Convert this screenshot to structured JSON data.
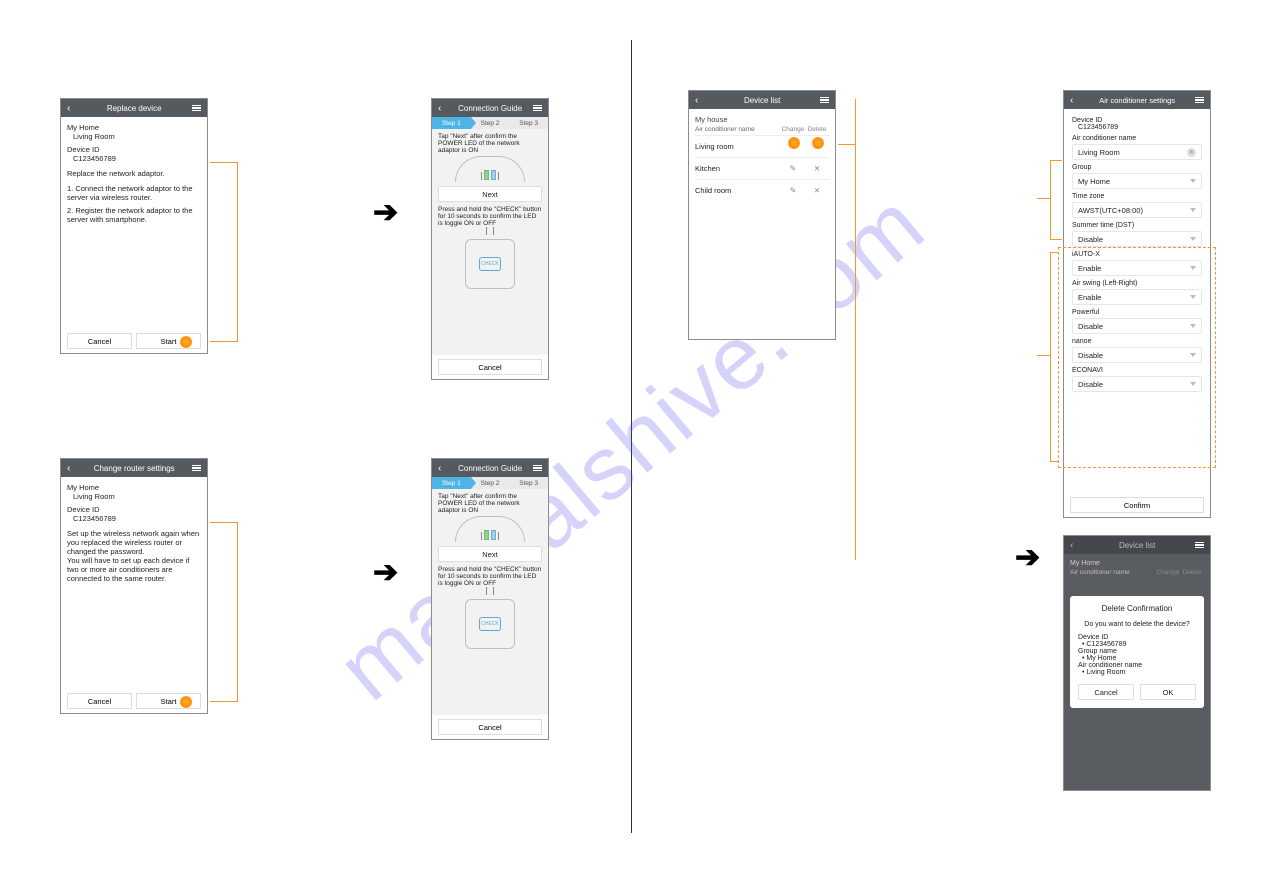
{
  "watermark": "manualshive.com",
  "screen1": {
    "title": "Replace device",
    "home_label": "My Home",
    "room": "Living Room",
    "devidlabel": "Device ID",
    "devid": "C123456789",
    "intro": "Replace the network adaptor.",
    "step1": "1. Connect the network adaptor to the server via wireless router.",
    "step2": "2. Register the network adaptor to the server with smartphone.",
    "cancel": "Cancel",
    "start": "Start"
  },
  "screen2": {
    "title": "Change router settings",
    "home_label": "My Home",
    "room": "Living Room",
    "devidlabel": "Device ID",
    "devid": "C123456789",
    "text": "Set up the wireless network again when you replaced the wireless router or changed the password.\nYou will have to set up each device if two or more air conditioners are connected to the same router.",
    "cancel": "Cancel",
    "start": "Start"
  },
  "guide": {
    "title": "Connection Guide",
    "s1": "Step 1",
    "s2": "Step 2",
    "s3": "Step 3",
    "tap_next": "Tap \"Next\" after confirm the POWER LED of the network adaptor is ON",
    "next": "Next",
    "press_hold": "Press and hold the \"CHECK\" button for 10 seconds to confirm the LED is toggle ON or OFF",
    "check": "CHECK",
    "cancel": "Cancel"
  },
  "devlist": {
    "title": "Device list",
    "house": "My house",
    "colname": "Air conditioner name",
    "colchange": "Change",
    "coldelete": "Delete",
    "r1": "Living room",
    "r2": "Kitchen",
    "r3": "Child room"
  },
  "ac": {
    "title": "Air conditioner settings",
    "devidlabel": "Device ID",
    "devid": "C123456789",
    "namelabel": "Air conditioner name",
    "name": "Living Room",
    "grouplabel": "Group",
    "group": "My Home",
    "tzlabel": "Time zone",
    "tz": "AWST(UTC+08:00)",
    "dstlabel": "Summer time (DST)",
    "dst": "Disable",
    "iautoxlabel": "iAUTO-X",
    "iautox": "Enable",
    "airswinglabel": "Air swing (Left-Right)",
    "airswing": "Enable",
    "powerfulllabel": "Powerful",
    "powerful": "Disable",
    "nanolabel": "nanoe",
    "nano": "Disable",
    "econavilabel": "ECONAVI",
    "econavi": "Disable",
    "confirm": "Confirm"
  },
  "dlg": {
    "title": "Device list",
    "house": "My Home",
    "colname": "Air conditioner name",
    "colchange": "Change",
    "coldelete": "Delete",
    "heading": "Delete Confirmation",
    "q": "Do you want to delete the device?",
    "devidlbl": "Device ID",
    "devid": "• C123456789",
    "grouplbl": "Group name",
    "group": "• My Home",
    "acnamelbl": "Air conditioner name",
    "acname": "• Living Room",
    "cancel": "Cancel",
    "ok": "OK"
  }
}
